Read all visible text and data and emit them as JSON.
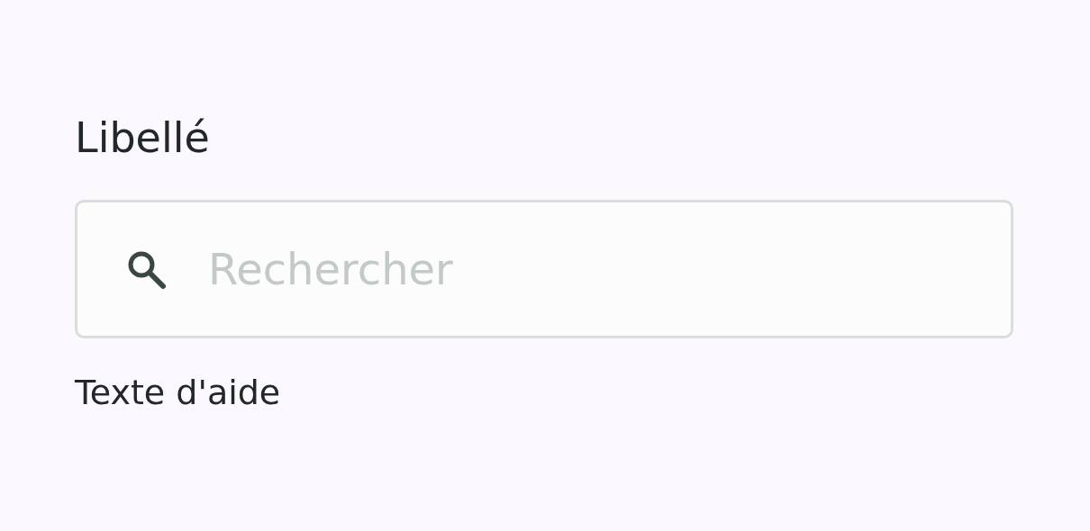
{
  "label": "Libellé",
  "search": {
    "placeholder": "Rechercher"
  },
  "helper_text": "Texte d'aide"
}
